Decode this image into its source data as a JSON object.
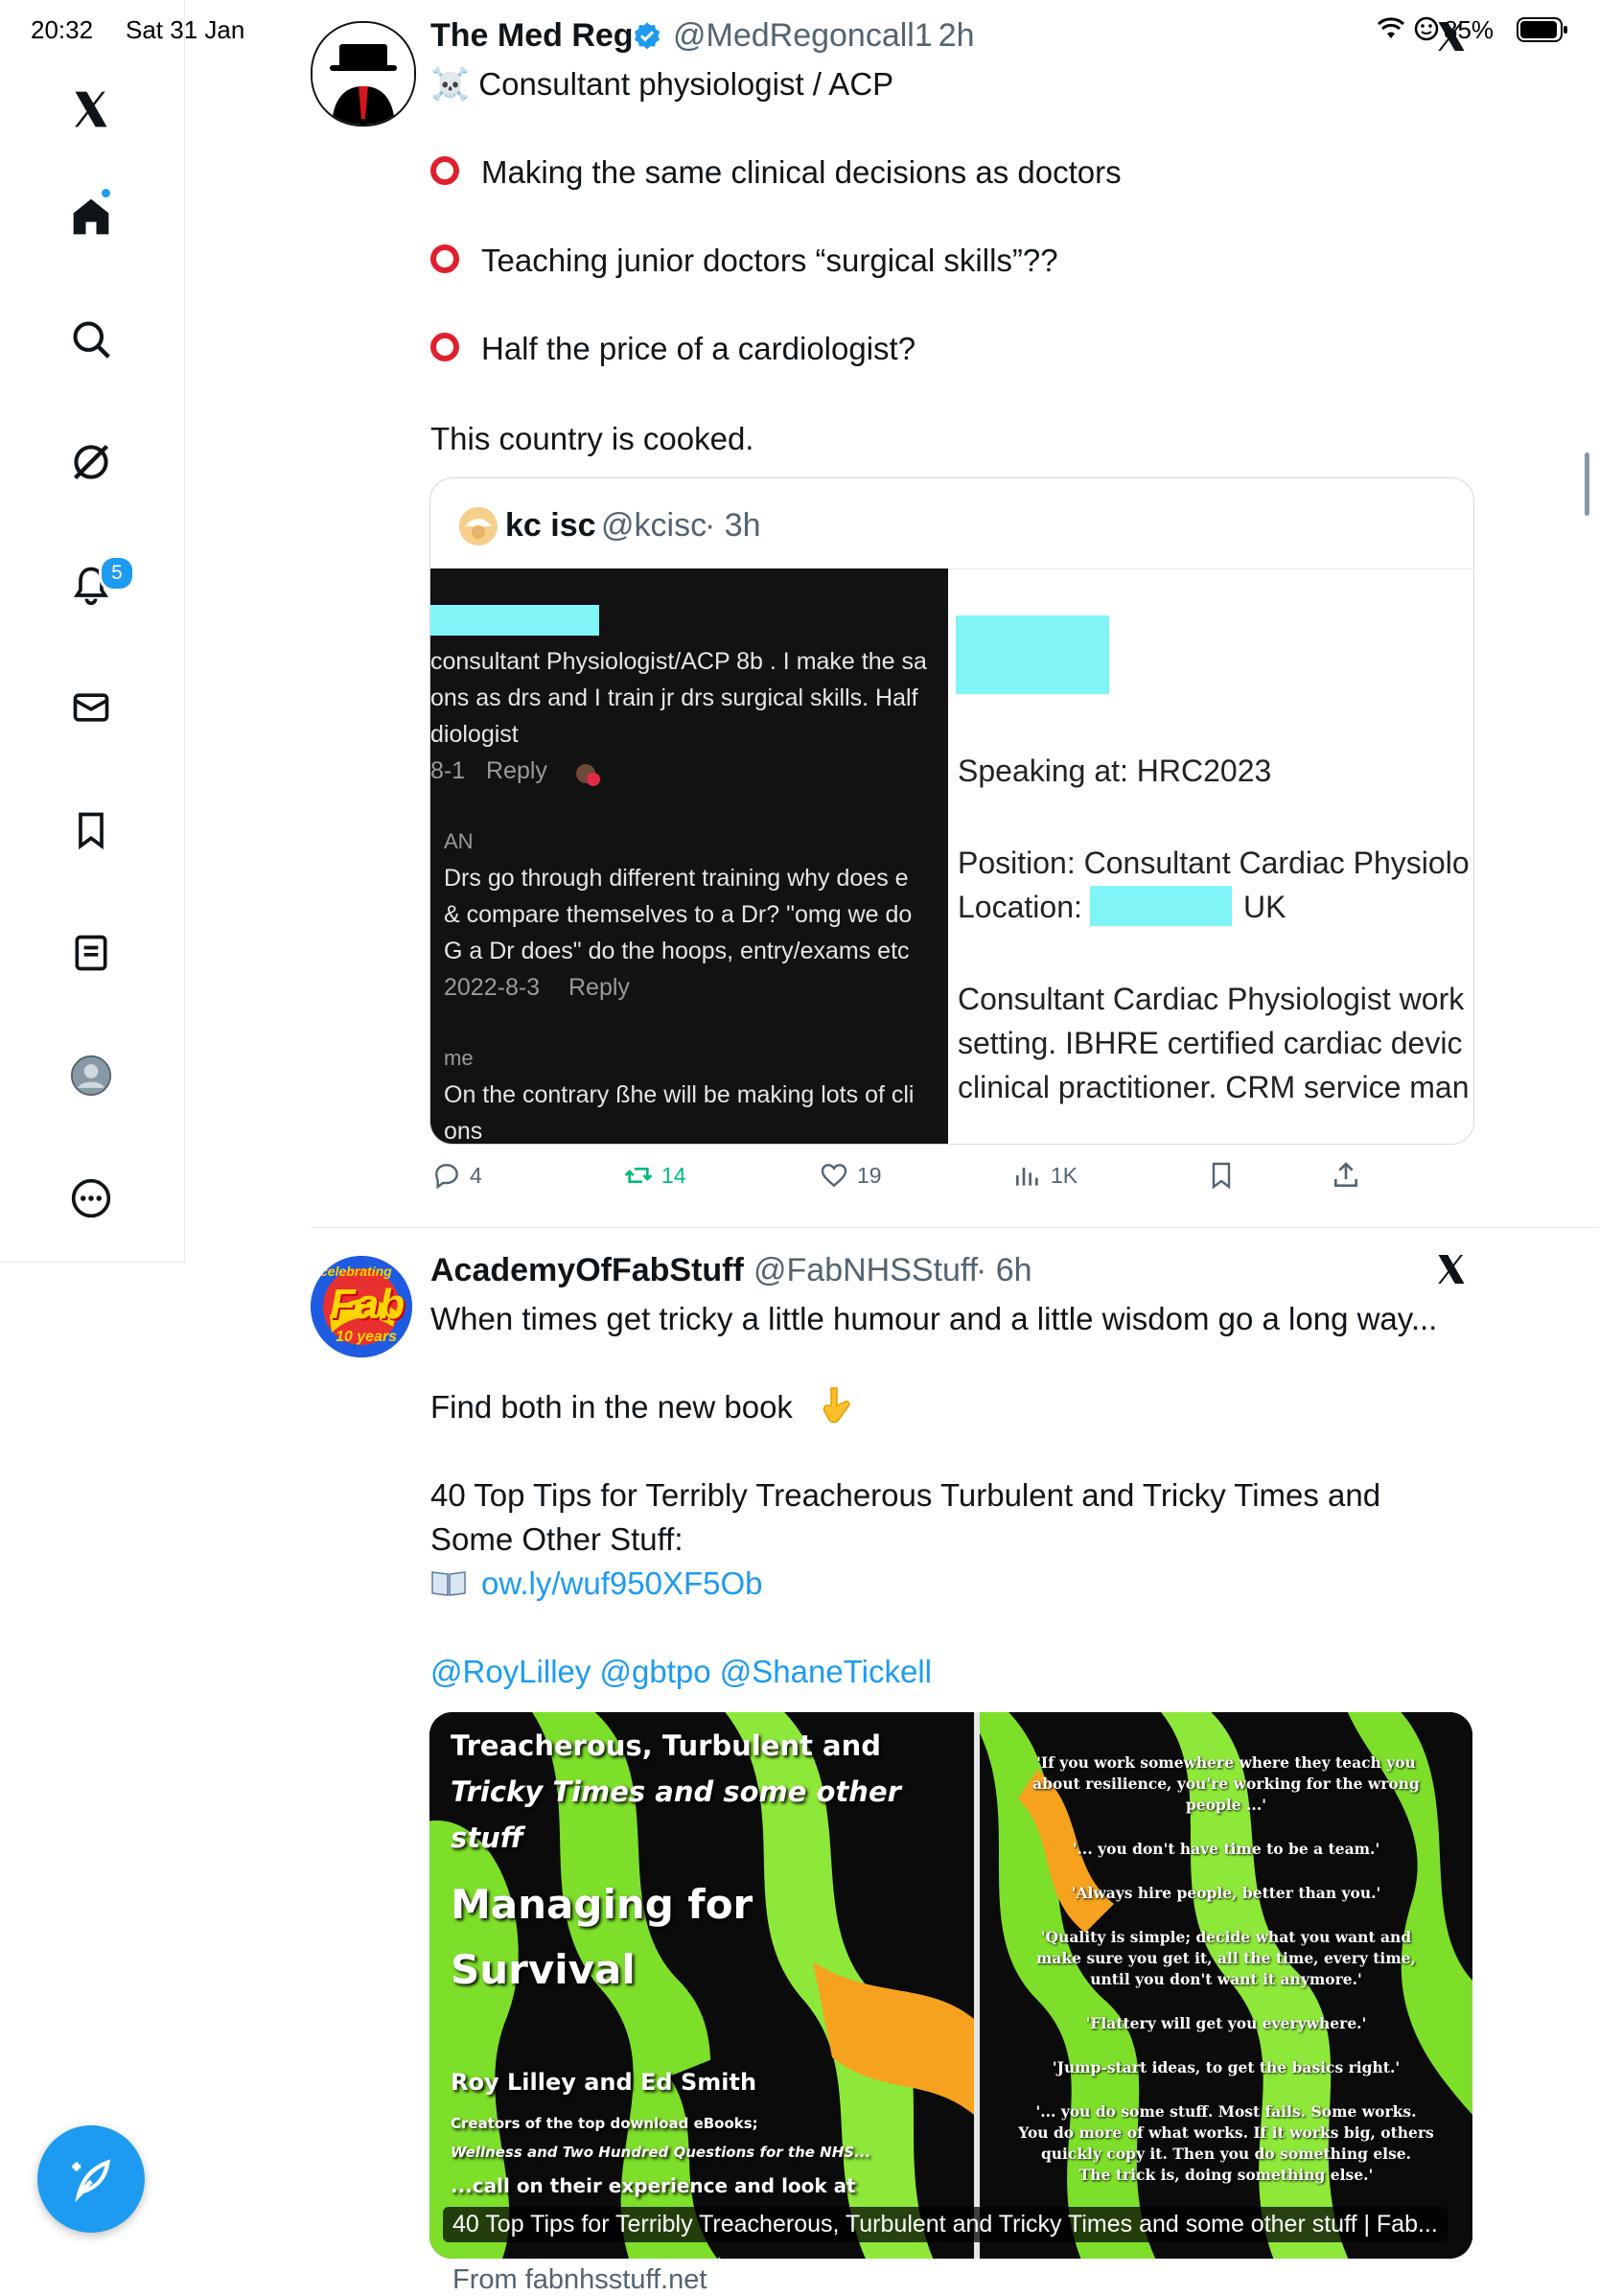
{
  "status_bar": {
    "time": "20:32",
    "date": "Sat 31 Jan",
    "battery": "85%"
  },
  "sidebar": {
    "items": [
      {
        "name": "home",
        "icon": "home-icon"
      },
      {
        "name": "explore",
        "icon": "search-icon"
      },
      {
        "name": "grok",
        "icon": "grok-icon"
      },
      {
        "name": "notifications",
        "icon": "bell-icon",
        "badge": "5"
      },
      {
        "name": "messages",
        "icon": "mail-icon"
      },
      {
        "name": "bookmarks",
        "icon": "bookmark-icon"
      },
      {
        "name": "lists",
        "icon": "list-icon"
      },
      {
        "name": "profile",
        "icon": "avatar-icon"
      },
      {
        "name": "more",
        "icon": "more-icon"
      }
    ],
    "compose_icon": "compose-icon"
  },
  "tweet1": {
    "name": "The Med Reg",
    "handle": "@MedRegoncall1",
    "time": "· 2h",
    "lines": [
      "☠️ Consultant physiologist / ACP",
      "Making the same clinical decisions as doctors",
      "Teaching junior doctors “surgical skills”??",
      "Half the price of a cardiologist?",
      "This country is cooked."
    ],
    "quote": {
      "name": "kc isc",
      "handle": "@kcisc",
      "time": "· 3h",
      "left_image": {
        "line1": "consultant Physiologist/ACP 8b . I make the sa",
        "line2": "ons as drs and I train jr drs surgical skills. Half",
        "line3": "diologist",
        "meta1_date": "8-1",
        "meta1_reply": "Reply",
        "user2": "AN",
        "c2_line1": "Drs go through different training why does e",
        "c2_line2": "& compare themselves to a Dr? \"omg we do",
        "c2_line3": "G a Dr does\" do the hoops, entry/exams etc",
        "meta2_date": "2022-8-3",
        "meta2_reply": "Reply",
        "user3": "me",
        "c3_line1": "On the contrary ßhe will be making lots of cli",
        "c3_line2": "ons"
      },
      "right_image": {
        "speaking": "Speaking at: HRC2023",
        "position": "Position: Consultant Cardiac Physiolo",
        "location_label": "Location:",
        "location_country": "UK",
        "bio1": "Consultant Cardiac Physiologist work",
        "bio2": "setting. IBHRE certified cardiac devic",
        "bio3": "clinical practitioner. CRM service man"
      }
    },
    "actions": {
      "replies": "4",
      "reposts": "14",
      "likes": "19",
      "views": "1K"
    }
  },
  "tweet2": {
    "name": "AcademyOfFabStuff",
    "handle": "@FabNHSStuff",
    "time": "· 6h",
    "avatar": {
      "top": "celebrating",
      "main": "Fab",
      "bottom": "10 years"
    },
    "line1": "When times get tricky a little humour and a little wisdom go a long way...",
    "line2": "Find both in the new book",
    "line3": "40 Top Tips for Terribly Treacherous Turbulent and Tricky Times and",
    "line4": "Some Other Stuff:",
    "link": "ow.ly/wuf950XF5Ob",
    "mentions": "@RoyLilley @gbtpo @ShaneTickell",
    "card": {
      "title1": "Treacherous, Turbulent and",
      "title2": "Tricky Times and some other",
      "title3": "stuff",
      "subtitle1": "Managing for",
      "subtitle2": "Survival",
      "authors": "Roy Lilley and Ed Smith",
      "creators1": "Creators of the top download eBooks;",
      "creators2": "Wellness and Two Hundred Questions for the NHS...",
      "call": "...call on their experience and look at",
      "quotes": [
        "'If you work somewhere where they teach you",
        "about resilience, you're working for the wrong",
        "people ...'",
        "'... you don't have time to be a team.'",
        "'Always hire people, better than you.'",
        "'Quality is simple; decide what you want and",
        "make sure you get it, all the time, every time,",
        "until you don't want it anymore.'",
        "'Flattery will get you everywhere.'",
        "'Jump-start ideas, to get the basics right.'",
        "'... you do some stuff. Most fails. Some works.",
        "You do more of what works. If it works big, others",
        "quickly copy it. Then you do something else.",
        "The trick is, doing something else.'"
      ],
      "caption": "40 Top Tips for Terribly Treacherous, Turbulent and Tricky Times and some other stuff | Fab...",
      "source": "From fabnhsstuff.net"
    }
  }
}
